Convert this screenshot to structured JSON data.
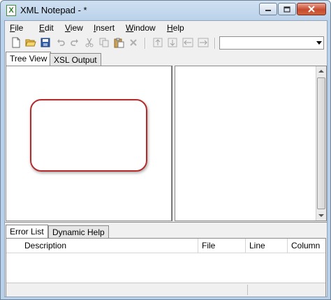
{
  "window": {
    "title": "XML Notepad - *",
    "app_icon_glyph": "X",
    "controls": [
      "minimize-icon",
      "maximize-icon",
      "close-icon"
    ]
  },
  "menu": {
    "items": [
      {
        "label": "File",
        "mnemonic": "F",
        "rest": "ile"
      },
      {
        "label": "Edit",
        "mnemonic": "E",
        "rest": "dit"
      },
      {
        "label": "View",
        "mnemonic": "V",
        "rest": "iew"
      },
      {
        "label": "Insert",
        "mnemonic": "I",
        "rest": "nsert"
      },
      {
        "label": "Window",
        "mnemonic": "W",
        "rest": "indow"
      },
      {
        "label": "Help",
        "mnemonic": "H",
        "rest": "elp"
      }
    ]
  },
  "toolbar": {
    "icons": [
      "new-file-icon",
      "open-folder-icon",
      "save-icon",
      "undo-icon",
      "redo-icon",
      "cut-icon",
      "copy-icon",
      "paste-icon",
      "delete-icon",
      "nudge-up-icon",
      "nudge-down-icon",
      "nudge-left-icon",
      "nudge-right-icon"
    ],
    "location_combo_value": ""
  },
  "top_tabs": [
    "Tree View",
    "XSL Output"
  ],
  "bottom_tabs": [
    "Error List",
    "Dynamic Help"
  ],
  "error_list": {
    "columns": [
      "Description",
      "File",
      "Line",
      "Column"
    ],
    "rows": []
  },
  "colors": {
    "highlight_outline": "#b52a2a",
    "title_bar": "#b9d1ea"
  }
}
